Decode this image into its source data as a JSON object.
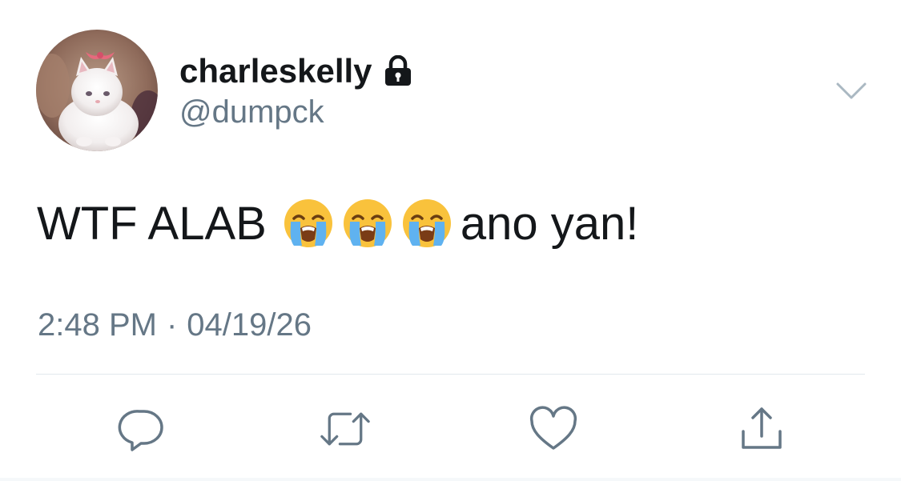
{
  "user": {
    "display_name": "charleskelly",
    "handle": "@dumpck",
    "protected_icon": "lock-icon",
    "avatar": "cat-avatar"
  },
  "tweet": {
    "text_start": "WTF ALAB",
    "emojis": [
      "loudly-crying-face",
      "loudly-crying-face",
      "loudly-crying-face"
    ],
    "text_end": "ano yan!",
    "time": "2:48 PM",
    "separator": "·",
    "date": "04/19/26"
  },
  "actions": [
    {
      "name": "reply",
      "icon": "reply-icon"
    },
    {
      "name": "retweet",
      "icon": "retweet-icon"
    },
    {
      "name": "like",
      "icon": "heart-icon"
    },
    {
      "name": "share",
      "icon": "share-icon"
    }
  ],
  "colors": {
    "text": "#14171a",
    "secondary": "#657786",
    "divider": "#e1e8ed"
  }
}
